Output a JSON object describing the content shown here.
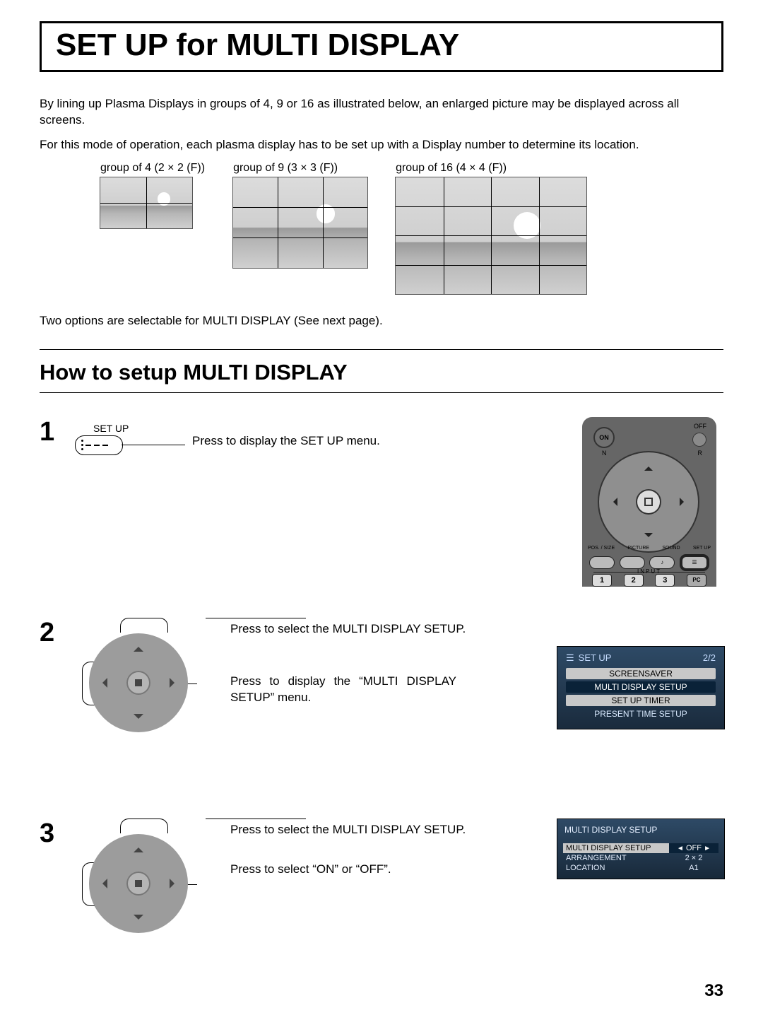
{
  "title": "SET UP for MULTI DISPLAY",
  "intro1": "By lining up Plasma Displays in groups of 4, 9 or 16 as illustrated below, an enlarged picture may be displayed across all screens.",
  "intro2": "For this mode of operation, each plasma display has to be set up with a Display number to determine its location.",
  "groups": {
    "g4": "group of 4 (2 × 2 (F))",
    "g9": "group of 9 (3 × 3 (F))",
    "g16": "group of 16 (4 × 4 (F))"
  },
  "note": "Two options are selectable for MULTI DISPLAY (See next page).",
  "howto": "How to setup MULTI DISPLAY",
  "steps": {
    "n1": "1",
    "n2": "2",
    "n3": "3",
    "s1": {
      "btn": "SET UP",
      "text": "Press to display the SET UP menu."
    },
    "s2": {
      "a": "Press to select the MULTI DISPLAY SETUP.",
      "b": "Press to display the “MULTI DISPLAY SETUP” menu."
    },
    "s3": {
      "a": "Press to select the MULTI DISPLAY SETUP.",
      "b": "Press to select “ON” or “OFF”."
    }
  },
  "remote": {
    "on": "ON",
    "off": "OFF",
    "n": "N",
    "r": "R",
    "labels": {
      "pos": "POS. / SIZE",
      "pic": "PICTURE",
      "snd": "SOUND",
      "setup": "SET UP"
    },
    "input": "INPUT",
    "nums": {
      "n1": "1",
      "n2": "2",
      "n3": "3",
      "pc": "PC"
    }
  },
  "osd1": {
    "title": "SET UP",
    "page": "2/2",
    "items": [
      "SCREENSAVER",
      "MULTI DISPLAY SETUP",
      "SET UP TIMER",
      "PRESENT TIME SETUP"
    ]
  },
  "osd2": {
    "title": "MULTI DISPLAY SETUP",
    "rows": {
      "r1": {
        "k": "MULTI DISPLAY SETUP",
        "v": "OFF"
      },
      "r2": {
        "k": "ARRANGEMENT",
        "v": "2 × 2"
      },
      "r3": {
        "k": "LOCATION",
        "v": "A1"
      }
    }
  },
  "pagenum": "33"
}
